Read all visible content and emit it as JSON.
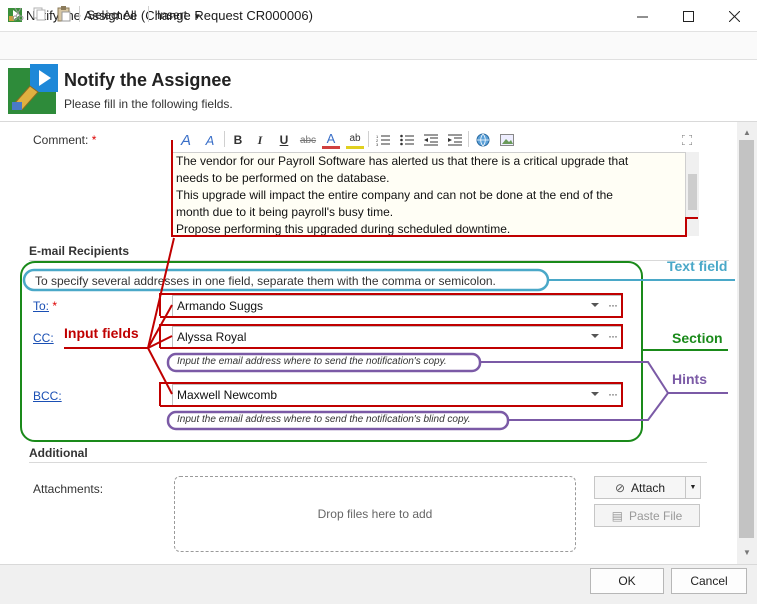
{
  "window": {
    "title": "Notify the Assignee (Change Request CR000006)"
  },
  "toolbar": {
    "cut_icon": "scissors-icon",
    "copy_icon": "copy-icon",
    "paste_icon": "paste-icon",
    "select_all_label": "Select All",
    "insert_label": "Insert"
  },
  "header": {
    "title": "Notify the Assignee",
    "subtitle": "Please fill in the following fields."
  },
  "comment": {
    "label": "Comment:",
    "required_mark": "*",
    "lines": [
      "The vendor for our Payroll Software has alerted us that there is a critical upgrade that",
      "needs to be performed on the database.",
      "This upgrade will impact the entire company and can not be done at the end of the",
      "month due to it being payroll's busy time.",
      "Propose performing this upgraded during scheduled downtime."
    ]
  },
  "recipients": {
    "section_title": "E-mail Recipients",
    "info_text": "To specify several addresses in one field, separate them with the comma or semicolon.",
    "to_label": "To:",
    "to_required": "*",
    "to_value": "Armando Suggs",
    "cc_label": "CC:",
    "cc_value": "Alyssa Royal",
    "cc_hint": "Input the email address where to send the notification's copy.",
    "bcc_label": "BCC:",
    "bcc_value": "Maxwell Newcomb",
    "bcc_hint": "Input the email address where to send the notification's blind copy."
  },
  "additional": {
    "section_title": "Additional",
    "attachments_label": "Attachments:",
    "drop_text": "Drop files here to add",
    "attach_label": "Attach",
    "paste_file_label": "Paste File"
  },
  "annotations": {
    "text_field": "Text field",
    "input_fields": "Input fields",
    "section": "Section",
    "hints": "Hints"
  },
  "footer": {
    "ok_label": "OK",
    "cancel_label": "Cancel"
  },
  "colors": {
    "input_annotation": "#c00000",
    "section_annotation": "#1a8a1a",
    "text_field_annotation": "#4aa8c8",
    "hints_annotation": "#7b5aa6",
    "link": "#1a4fb4"
  }
}
